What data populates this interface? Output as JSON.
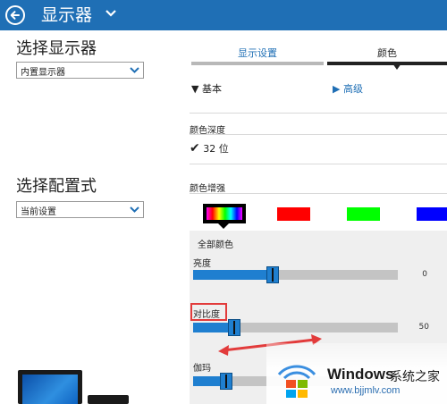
{
  "header": {
    "title": "显示器",
    "back_icon": "back-arrow-circle-icon",
    "chevron_icon": "chevron-down-icon",
    "background": "#1f6fb5"
  },
  "left": {
    "select_display_title": "选择显示器",
    "display_select_value": "内置显示器",
    "select_profile_title": "选择配置式",
    "profile_select_value": "当前设置"
  },
  "tabs": {
    "display_settings": "显示设置",
    "color": "颜色",
    "active": "颜色"
  },
  "modes": {
    "basic": "基本",
    "advanced": "高级"
  },
  "color_depth": {
    "heading": "颜色深度",
    "value": "32 位"
  },
  "color_enhance": {
    "heading": "颜色增强",
    "swatches": [
      "#000000",
      "#ff0000",
      "#00ff00",
      "#0000ff"
    ],
    "selected": "all",
    "all_colors_label": "全部颜色"
  },
  "sliders": [
    {
      "label": "亮度",
      "value": "0",
      "level": 0.39
    },
    {
      "label": "对比度",
      "value": "50",
      "level": 0.2
    },
    {
      "label": "伽玛",
      "value": "",
      "level": 0.16
    }
  ],
  "annotations": {
    "highlight_color": "#e23b3b",
    "arrow_color": "#e23b3b"
  },
  "watermark": {
    "brand": "Windows",
    "brand_suffix": "系统之家",
    "url": "www.bjjmlv.com"
  }
}
